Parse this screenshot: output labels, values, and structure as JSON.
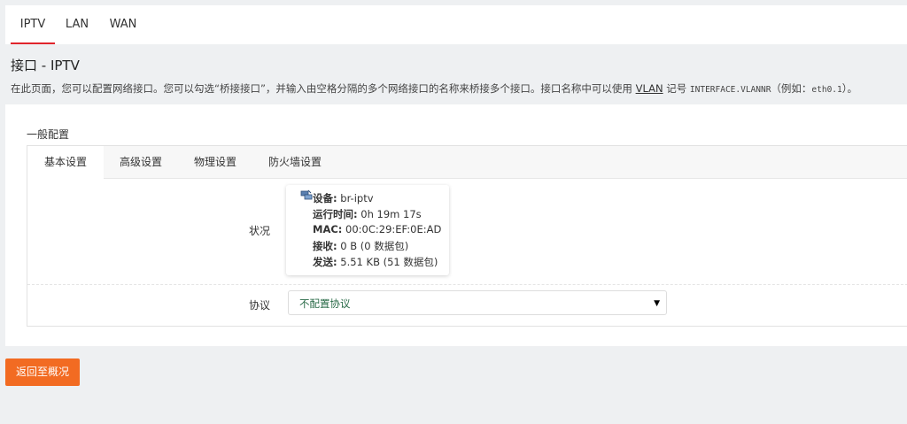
{
  "topnav": {
    "tabs": [
      {
        "label": "IPTV",
        "active": true
      },
      {
        "label": "LAN",
        "active": false
      },
      {
        "label": "WAN",
        "active": false
      }
    ]
  },
  "page": {
    "title": "接口 - IPTV",
    "desc_prefix": "在此页面，您可以配置网络接口。您可以勾选“桥接接口”，并输入由空格分隔的多个网络接口的名称来桥接多个接口。接口名称中可以使用 ",
    "desc_link": "VLAN",
    "desc_mid": " 记号 ",
    "desc_code1": "INTERFACE.VLANNR",
    "desc_mid2": "（例如：",
    "desc_code2": "eth0.1",
    "desc_suffix": "）。"
  },
  "config": {
    "legend": "一般配置",
    "tabs": [
      {
        "label": "基本设置",
        "active": true
      },
      {
        "label": "高级设置",
        "active": false
      },
      {
        "label": "物理设置",
        "active": false
      },
      {
        "label": "防火墙设置",
        "active": false
      }
    ],
    "status": {
      "label": "状况",
      "device_key": "设备:",
      "device_val": "br-iptv",
      "uptime_key": "运行时间:",
      "uptime_val": "0h 19m 17s",
      "mac_key": "MAC:",
      "mac_val": "00:0C:29:EF:0E:AD",
      "rx_key": "接收:",
      "rx_val": "0 B (0 数据包)",
      "tx_key": "发送:",
      "tx_val": "5.51 KB (51 数据包)"
    },
    "protocol": {
      "label": "协议",
      "selected": "不配置协议"
    }
  },
  "actions": {
    "back_label": "返回至概况"
  },
  "colors": {
    "accent_red": "#e0242b",
    "button_orange": "#f26b22",
    "select_text": "#2a6b48"
  }
}
